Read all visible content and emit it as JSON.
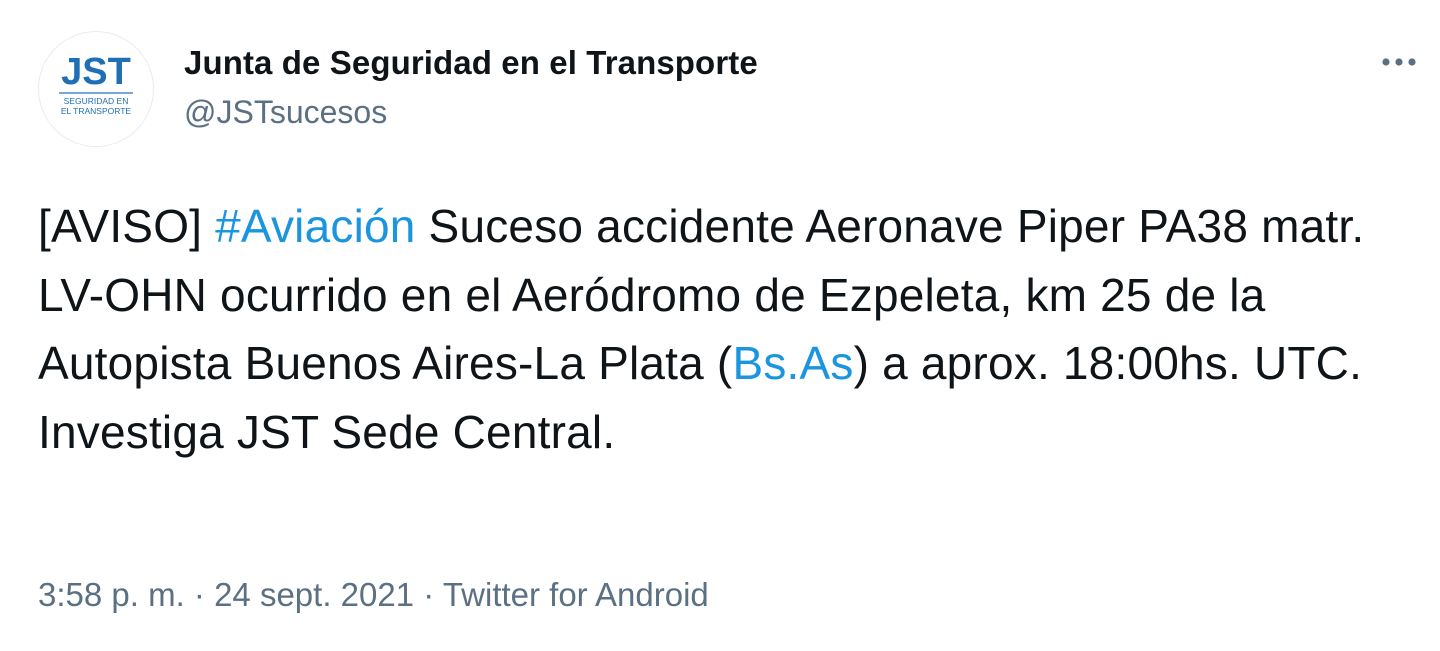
{
  "tweet": {
    "author": {
      "display_name": "Junta de Seguridad en el Transporte",
      "handle": "@JSTsucesos",
      "avatar": {
        "logo_text": "JST",
        "tagline_line1": "SEGURIDAD EN",
        "tagline_line2": "EL TRANSPORTE",
        "colors": {
          "logo": "#1f6fb5",
          "tagline": "#1f6fb5",
          "background": "#ffffff"
        }
      }
    },
    "more_icon": "more-horizontal-icon",
    "text": {
      "part1": "[AVISO] ",
      "hashtag": "#Aviación",
      "part2": " Suceso accidente Aeronave Piper PA38 matr. LV-OHN ocurrido en el Aeródromo de Ezpeleta, km 25 de la Autopista Buenos Aires-La Plata (",
      "mention_link": "Bs.As",
      "part3": ") a aprox. 18:00hs. UTC. Investiga JST Sede Central."
    },
    "meta": {
      "time": "3:58 p. m.",
      "separator1": " · ",
      "date": "24 sept. 2021",
      "separator2": " · ",
      "source": "Twitter for Android"
    }
  },
  "colors": {
    "text": "#0f1419",
    "secondary": "#5b7083",
    "link": "#1b95e0",
    "background": "#ffffff"
  }
}
